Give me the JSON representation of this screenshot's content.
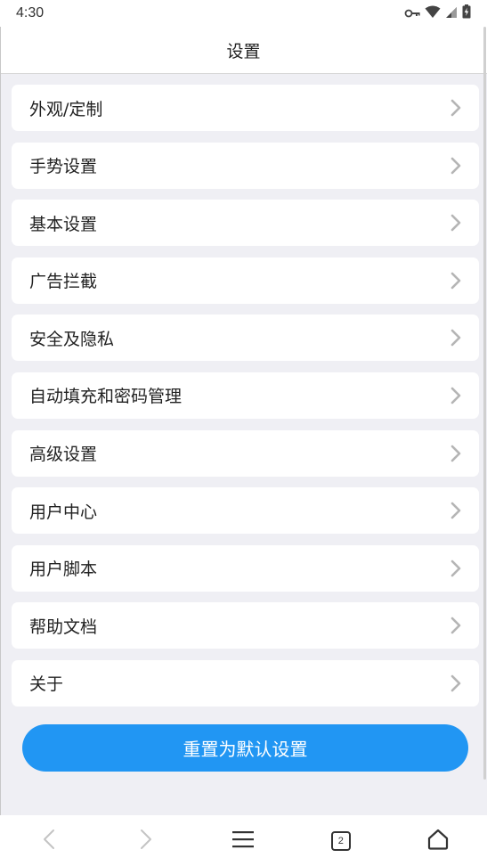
{
  "status_bar": {
    "time": "4:30"
  },
  "header": {
    "title": "设置"
  },
  "settings": {
    "items": [
      {
        "label": "外观/定制"
      },
      {
        "label": "手势设置"
      },
      {
        "label": "基本设置"
      },
      {
        "label": "广告拦截"
      },
      {
        "label": "安全及隐私"
      },
      {
        "label": "自动填充和密码管理"
      },
      {
        "label": "高级设置"
      },
      {
        "label": "用户中心"
      },
      {
        "label": "用户脚本"
      },
      {
        "label": "帮助文档"
      },
      {
        "label": "关于"
      }
    ]
  },
  "reset": {
    "label": "重置为默认设置"
  },
  "bottom_nav": {
    "tab_count": "2"
  },
  "colors": {
    "accent": "#2196f3",
    "background": "#efeff4",
    "card": "#ffffff",
    "chevron": "#b5b5b5"
  }
}
